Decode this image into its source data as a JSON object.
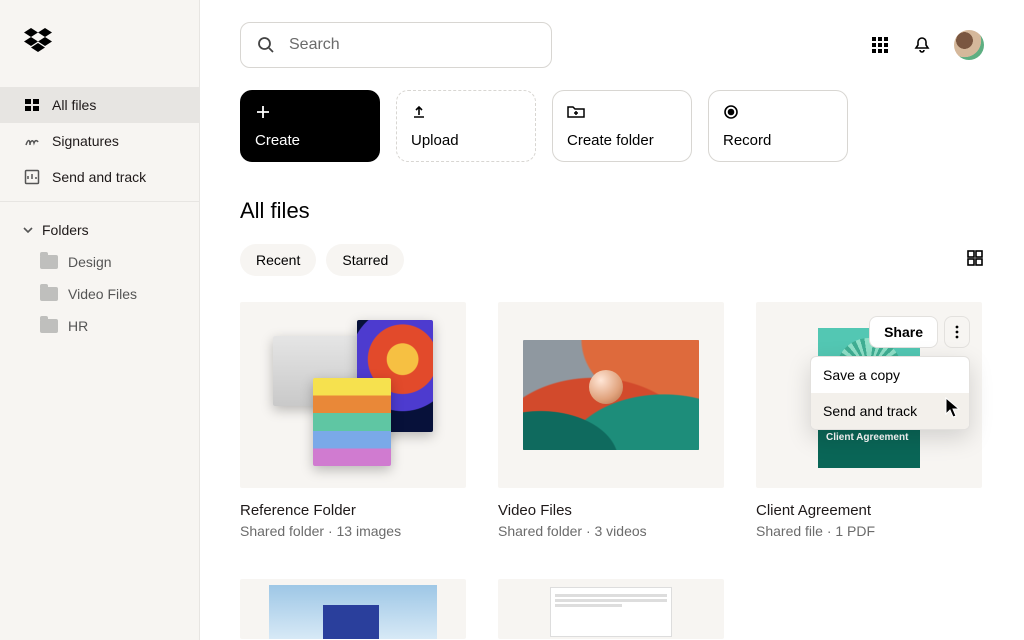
{
  "search": {
    "placeholder": "Search"
  },
  "nav": {
    "all_files": "All files",
    "signatures": "Signatures",
    "send_track": "Send and track"
  },
  "folders_header": "Folders",
  "folders": {
    "design": "Design",
    "video": "Video Files",
    "hr": "HR"
  },
  "actions": {
    "create": "Create",
    "upload": "Upload",
    "create_folder": "Create folder",
    "record": "Record"
  },
  "page_title": "All files",
  "chips": {
    "recent": "Recent",
    "starred": "Starred"
  },
  "tiles": {
    "t1": {
      "title": "Reference Folder",
      "meta": "Shared folder · 13 images"
    },
    "t2": {
      "title": "Video Files",
      "meta": "Shared folder · 3 videos"
    },
    "t3": {
      "title": "Client Agreement",
      "meta": "Shared file · 1 PDF",
      "doc_label": "Client Agreement"
    }
  },
  "share_label": "Share",
  "menu": {
    "save_copy": "Save a copy",
    "send_track": "Send and track"
  }
}
